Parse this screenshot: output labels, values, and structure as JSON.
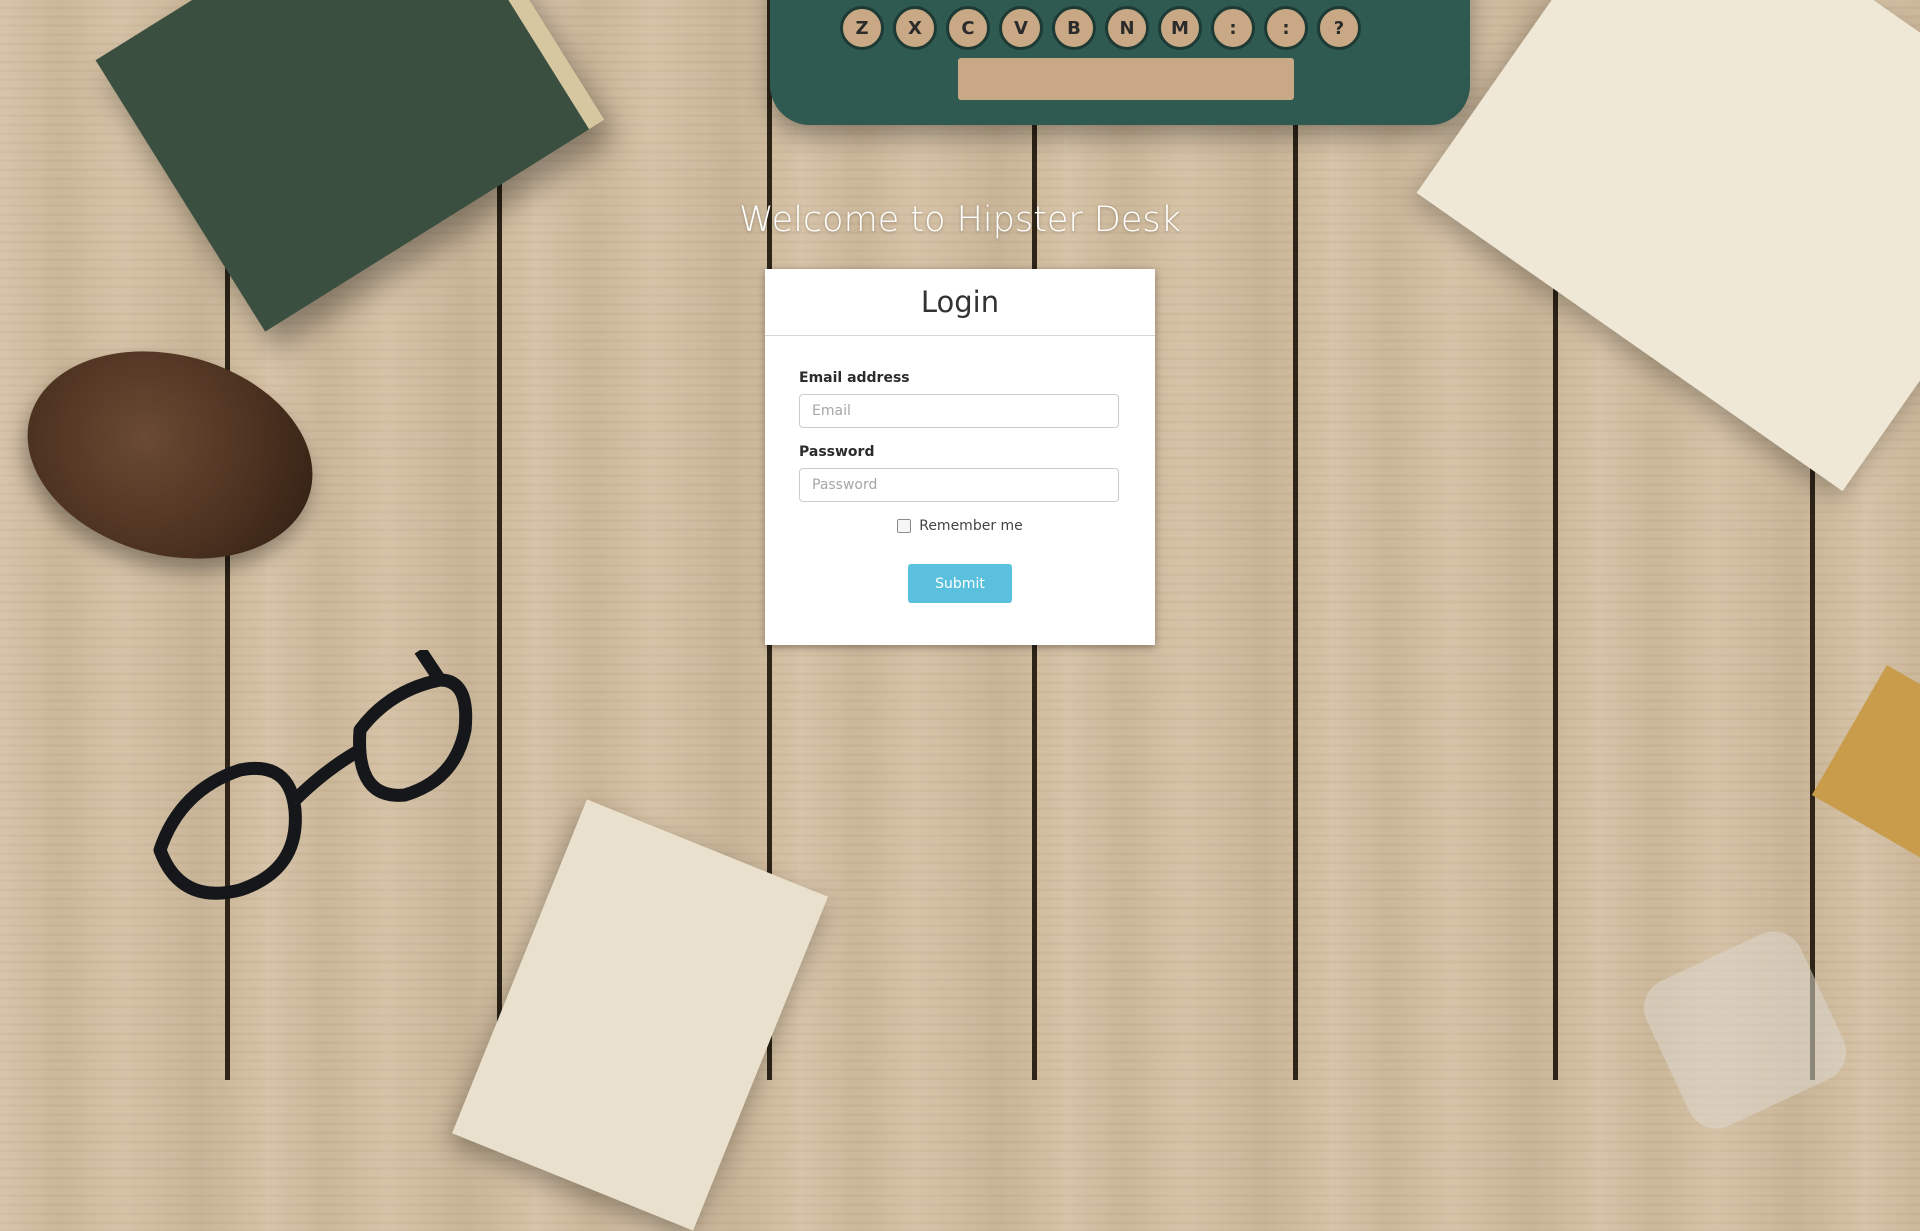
{
  "welcome_title": "Welcome to Hipster Desk",
  "login": {
    "title": "Login",
    "email": {
      "label": "Email address",
      "placeholder": "Email",
      "value": ""
    },
    "password": {
      "label": "Password",
      "placeholder": "Password",
      "value": ""
    },
    "remember_label": "Remember me",
    "remember_checked": false,
    "submit_label": "Submit"
  },
  "colors": {
    "submit_button": "#5bc0de",
    "card": "#ffffff",
    "wood": "#d2bc9d"
  },
  "background": {
    "typewriter_keys": [
      "Z",
      "X",
      "C",
      "V",
      "B",
      "N",
      "M",
      ":",
      ":",
      "?"
    ]
  }
}
